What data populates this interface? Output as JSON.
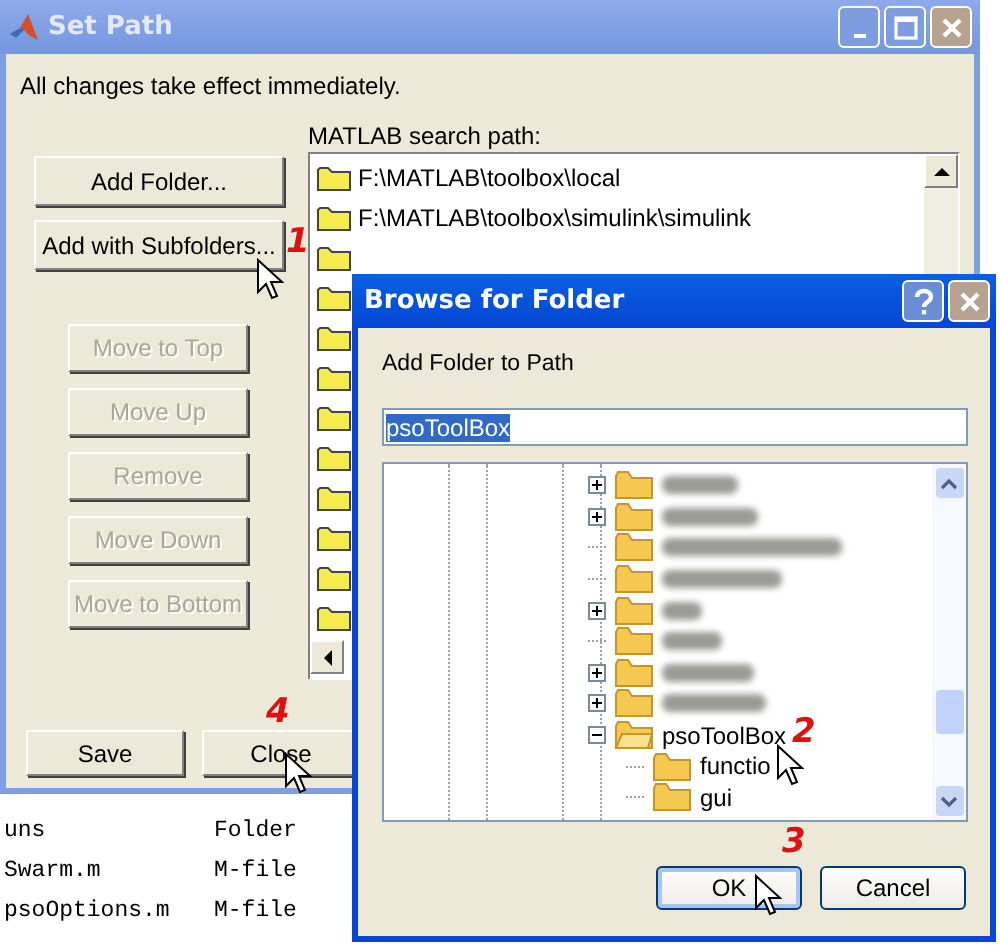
{
  "set_path": {
    "title": "Set Path",
    "notice": "All changes take effect immediately.",
    "side_buttons": [
      {
        "label": "Add Folder...",
        "disabled": false
      },
      {
        "label": "Add with Subfolders...",
        "disabled": false
      },
      {
        "label": "Move to Top",
        "disabled": true
      },
      {
        "label": "Move Up",
        "disabled": true
      },
      {
        "label": "Remove",
        "disabled": true
      },
      {
        "label": "Move Down",
        "disabled": true
      },
      {
        "label": "Move to Bottom",
        "disabled": true
      }
    ],
    "path_label": "MATLAB search path:",
    "path_items": [
      {
        "text": "F:\\MATLAB\\toolbox\\local"
      },
      {
        "text": "F:\\MATLAB\\toolbox\\simulink\\simulink"
      }
    ],
    "footer_buttons": [
      {
        "label": "Save"
      },
      {
        "label": "Close"
      }
    ]
  },
  "file_list": [
    {
      "name": "uns",
      "type": "Folder"
    },
    {
      "name": "Swarm.m",
      "type": "M-file"
    },
    {
      "name": "psoOptions.m",
      "type": "M-file"
    }
  ],
  "browse": {
    "title": "Browse for Folder",
    "prompt": "Add Folder to Path",
    "folder_field": "psoToolBox",
    "tree": [
      {
        "kind": "blurred",
        "expandable": true,
        "expanded": false
      },
      {
        "kind": "blurred",
        "expandable": true,
        "expanded": false
      },
      {
        "kind": "blurred",
        "expandable": false,
        "expanded": false
      },
      {
        "kind": "blurred",
        "expandable": false,
        "expanded": false
      },
      {
        "kind": "blurred",
        "expandable": true,
        "expanded": false
      },
      {
        "kind": "blurred",
        "expandable": false,
        "expanded": false
      },
      {
        "kind": "blurred",
        "expandable": true,
        "expanded": false
      },
      {
        "kind": "blurred",
        "expandable": true,
        "expanded": false
      },
      {
        "kind": "named",
        "label": "psoToolBox",
        "expandable": true,
        "expanded": true,
        "children": [
          {
            "kind": "named",
            "label": "functio"
          },
          {
            "kind": "named",
            "label": "gui"
          }
        ]
      }
    ],
    "buttons": [
      {
        "label": "OK",
        "default": true
      },
      {
        "label": "Cancel",
        "default": false
      }
    ]
  },
  "annotations": [
    {
      "label": "1"
    },
    {
      "label": "4"
    },
    {
      "label": "2"
    },
    {
      "label": "3"
    }
  ]
}
